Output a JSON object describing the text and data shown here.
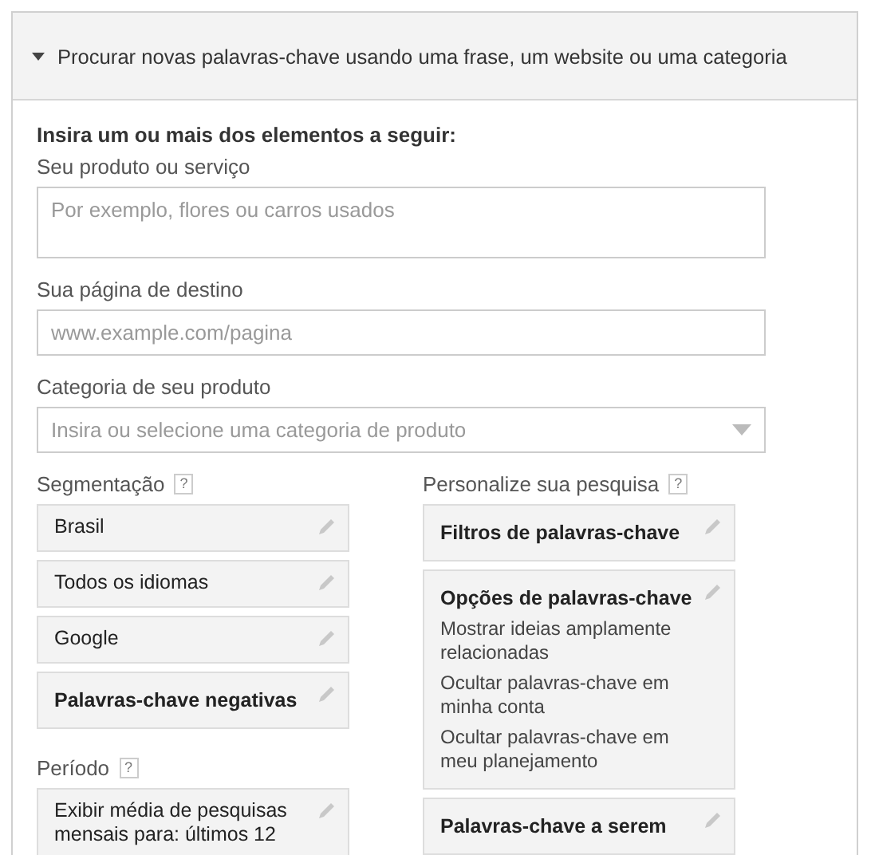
{
  "section": {
    "title": "Procurar novas palavras-chave usando uma frase, um website ou uma categoria",
    "expanded": true
  },
  "intro": "Insira um ou mais dos elementos a seguir:",
  "fields": [
    {
      "label": "Seu produto ou serviço",
      "placeholder": "Por exemplo, flores ou carros usados",
      "kind": "textarea"
    },
    {
      "label": "Sua página de destino",
      "placeholder": "www.example.com/pagina",
      "kind": "input"
    },
    {
      "label": "Categoria de seu produto",
      "placeholder": "Insira ou selecione uma categoria de produto",
      "kind": "select"
    }
  ],
  "left_groups": [
    {
      "title": "Segmentação",
      "help": "?",
      "cards": [
        {
          "kind": "plain",
          "text": "Brasil"
        },
        {
          "kind": "plain",
          "text": "Todos os idiomas"
        },
        {
          "kind": "plain",
          "text": "Google"
        },
        {
          "kind": "heading",
          "text": "Palavras-chave negativas"
        }
      ]
    },
    {
      "title": "Período",
      "help": "?",
      "cards": [
        {
          "kind": "plain",
          "text": "Exibir média de pesquisas mensais para: últimos 12"
        }
      ]
    }
  ],
  "right_groups": [
    {
      "title": "Personalize sua pesquisa",
      "help": "?",
      "cards": [
        {
          "kind": "heading",
          "text": "Filtros de palavras-chave"
        },
        {
          "kind": "heading",
          "text": "Opções de palavras-chave",
          "lines": [
            "Mostrar ideias amplamente relacionadas",
            "Ocultar palavras-chave em minha conta",
            "Ocultar palavras-chave em meu planejamento"
          ]
        },
        {
          "kind": "heading",
          "text": "Palavras-chave a serem"
        }
      ]
    }
  ]
}
